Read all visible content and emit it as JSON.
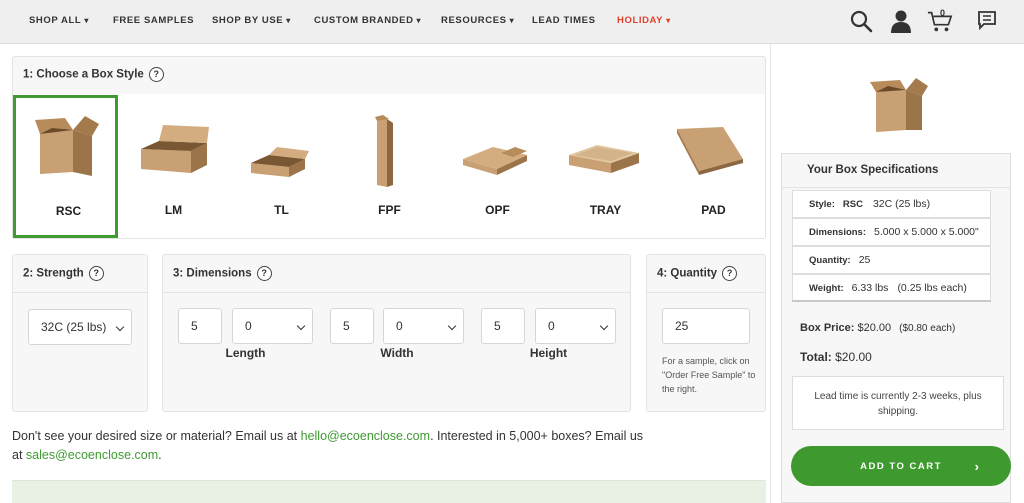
{
  "nav": {
    "items": [
      {
        "label": "SHOP ALL",
        "caret": "▾"
      },
      {
        "label": "FREE SAMPLES",
        "caret": ""
      },
      {
        "label": "SHOP BY USE",
        "caret": "▾"
      },
      {
        "label": "CUSTOM BRANDED",
        "caret": "▾"
      },
      {
        "label": "RESOURCES",
        "caret": "▾"
      },
      {
        "label": "LEAD TIMES",
        "caret": ""
      },
      {
        "label": "HOLIDAY",
        "caret": "▾"
      }
    ],
    "cart_count": "0",
    "accent_color": "#e0402e",
    "icons": [
      "search-icon",
      "account-icon",
      "cart-icon",
      "chat-icon"
    ]
  },
  "box_style": {
    "title": "1: Choose a Box Style",
    "help": "?",
    "styles": [
      "RSC",
      "LM",
      "TL",
      "FPF",
      "OPF",
      "TRAY",
      "PAD"
    ],
    "selected": "RSC"
  },
  "strength": {
    "title": "2: Strength",
    "help": "?",
    "value": "32C (25 lbs)"
  },
  "dimensions": {
    "title": "3: Dimensions",
    "help": "?",
    "length": {
      "whole": "5",
      "fraction": "0",
      "label": "Length"
    },
    "width": {
      "whole": "5",
      "fraction": "0",
      "label": "Width"
    },
    "height": {
      "whole": "5",
      "fraction": "0",
      "label": "Height"
    }
  },
  "quantity": {
    "title": "4: Quantity",
    "help": "?",
    "value": "25",
    "note": "For a sample, click on \"Order Free Sample\" to the right."
  },
  "footer": {
    "text1": "Don't see your desired size or material? Email us at ",
    "email1": "hello@ecoenclose.com",
    "text2": ". Interested in 5,000+ boxes? Email us at ",
    "email2": "sales@ecoenclose.com",
    "text3": "."
  },
  "spec": {
    "title": "Your Box Specifications",
    "style_label": "Style:",
    "style_value": "RSC",
    "style_detail": "32C (25 lbs)",
    "dimensions_label": "Dimensions:",
    "dimensions_value": "5.000 x 5.000 x 5.000\"",
    "quantity_label": "Quantity:",
    "quantity_value": "25",
    "weight_label": "Weight:",
    "weight_value": "6.33 lbs",
    "weight_each": "(0.25 lbs each)",
    "box_price_label": "Box Price:",
    "box_price_value": "$20.00",
    "box_price_each": "($0.80 each)",
    "total_label": "Total:",
    "total_value": "$20.00",
    "lead_time": "Lead time is currently 2-3 weeks, plus shipping.",
    "add_to_cart": "ADD TO CART",
    "add_to_cart_arrow": "›",
    "button_color": "#3e9a2f"
  }
}
